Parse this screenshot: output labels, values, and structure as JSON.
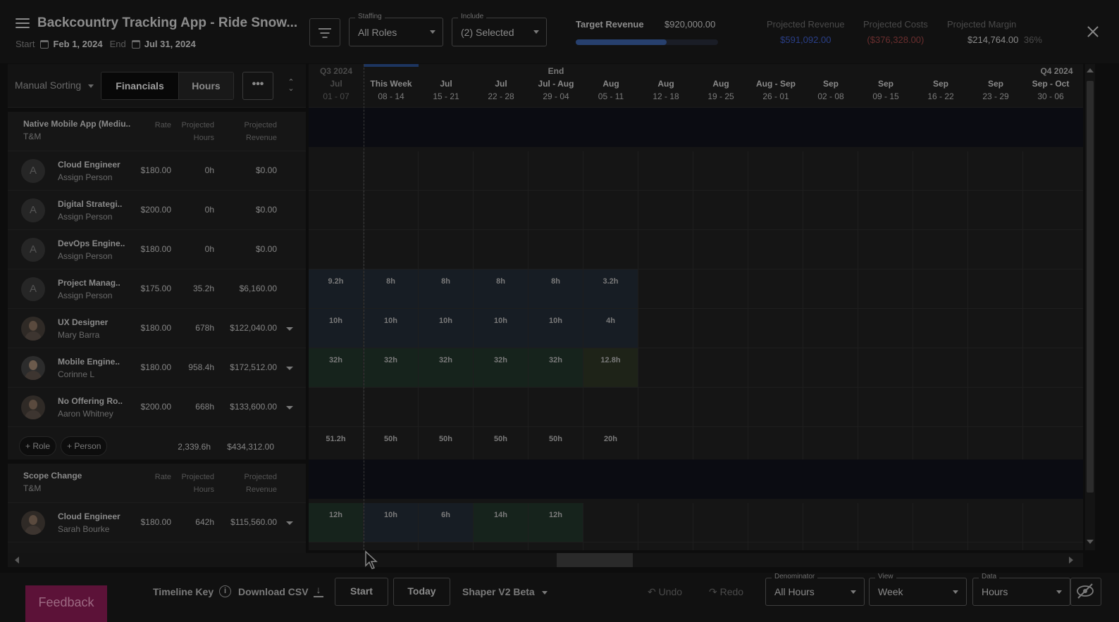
{
  "header": {
    "title": "Backcountry Tracking App - Ride Snow...",
    "start_label": "Start",
    "start_date": "Feb 1, 2024",
    "end_label": "End",
    "end_date": "Jul 31, 2024",
    "staffing": {
      "label": "Staffing",
      "value": "All Roles"
    },
    "include": {
      "label": "Include",
      "value": "(2) Selected"
    },
    "target_revenue": {
      "label": "Target Revenue",
      "value": "$920,000.00",
      "progress_fraction": 0.64
    },
    "projected_revenue": {
      "label": "Projected Revenue",
      "value": "$591,092.00",
      "color": "#2a3f88"
    },
    "projected_costs": {
      "label": "Projected Costs",
      "value": "($376,328.00)",
      "color": "#6a2e2e"
    },
    "projected_margin": {
      "label": "Projected Margin",
      "value": "$214,764.00",
      "percent": "36%"
    }
  },
  "panel": {
    "sorting": "Manual Sorting",
    "tab_financials": "Financials",
    "tab_hours": "Hours",
    "more": "•••"
  },
  "columns": {
    "rate": "Rate",
    "proj_hours_1": "Projected",
    "proj_hours_2": "Hours",
    "proj_rev_1": "Projected",
    "proj_rev_2": "Revenue"
  },
  "sections": [
    {
      "name": "Native Mobile App (Mediu..",
      "type": "T&M",
      "rows": [
        {
          "role": "Cloud Engineer",
          "person": "Assign Person",
          "avatar": "A",
          "rate": "$180.00",
          "hours": "0h",
          "revenue": "$0.00"
        },
        {
          "role": "Digital Strategi..",
          "person": "Assign Person",
          "avatar": "A",
          "rate": "$200.00",
          "hours": "0h",
          "revenue": "$0.00"
        },
        {
          "role": "DevOps Engine..",
          "person": "Assign Person",
          "avatar": "A",
          "rate": "$180.00",
          "hours": "0h",
          "revenue": "$0.00"
        },
        {
          "role": "Project Manag..",
          "person": "Assign Person",
          "avatar": "A",
          "rate": "$175.00",
          "hours": "35.2h",
          "revenue": "$6,160.00"
        },
        {
          "role": "UX Designer",
          "person": "Mary Barra",
          "avatar": "",
          "rate": "$180.00",
          "hours": "678h",
          "revenue": "$122,040.00"
        },
        {
          "role": "Mobile Engine..",
          "person": "Corinne L",
          "avatar": "",
          "rate": "$180.00",
          "hours": "958.4h",
          "revenue": "$172,512.00"
        },
        {
          "role": "No Offering Ro..",
          "person": "Aaron Whitney",
          "avatar": "",
          "rate": "$200.00",
          "hours": "668h",
          "revenue": "$133,600.00"
        }
      ],
      "footer": {
        "add_role": "+ Role",
        "add_person": "+ Person",
        "total_hours": "2,339.6h",
        "total_revenue": "$434,312.00"
      }
    },
    {
      "name": "Scope Change",
      "type": "T&M",
      "rows": [
        {
          "role": "Cloud Engineer",
          "person": "Sarah Bourke",
          "avatar": "",
          "rate": "$180.00",
          "hours": "642h",
          "revenue": "$115,560.00"
        }
      ]
    }
  ],
  "timeline": {
    "weeks": [
      {
        "quarter": "Q3 2024",
        "month": "Jul",
        "days": "01 - 07"
      },
      {
        "quarter": "",
        "month": "This Week",
        "days": "08 - 14"
      },
      {
        "quarter": "",
        "month": "Jul",
        "days": "15 - 21"
      },
      {
        "quarter": "",
        "month": "Jul",
        "days": "22 - 28"
      },
      {
        "quarter": "End",
        "month": "Jul - Aug",
        "days": "29 - 04"
      },
      {
        "quarter": "",
        "month": "Aug",
        "days": "05 - 11"
      },
      {
        "quarter": "",
        "month": "Aug",
        "days": "12 - 18"
      },
      {
        "quarter": "",
        "month": "Aug",
        "days": "19 - 25"
      },
      {
        "quarter": "",
        "month": "Aug - Sep",
        "days": "26 - 01"
      },
      {
        "quarter": "",
        "month": "Sep",
        "days": "02 - 08"
      },
      {
        "quarter": "",
        "month": "Sep",
        "days": "09 - 15"
      },
      {
        "quarter": "",
        "month": "Sep",
        "days": "16 - 22"
      },
      {
        "quarter": "",
        "month": "Sep",
        "days": "23 - 29"
      },
      {
        "quarter": "Q4 2024",
        "month": "Sep - Oct",
        "days": "30 - 06"
      }
    ],
    "rows": [
      {
        "cells": [
          "9.2h",
          "8h",
          "8h",
          "8h",
          "8h",
          "3.2h"
        ],
        "tone": "blue"
      },
      {
        "cells": [
          "10h",
          "10h",
          "10h",
          "10h",
          "10h",
          "4h"
        ],
        "tone": "blue"
      },
      {
        "cells": [
          "32h",
          "32h",
          "32h",
          "32h",
          "32h",
          "12.8h"
        ],
        "tone": "green",
        "last_tone": "yellow"
      },
      {
        "cells": [],
        "tone": "none"
      },
      {
        "cells": [
          "51.2h",
          "50h",
          "50h",
          "50h",
          "50h",
          "20h"
        ],
        "tone": "none"
      },
      {
        "cells": [
          "12h",
          "10h",
          "6h",
          "14h",
          "12h"
        ],
        "tones": [
          "green",
          "blue",
          "blue",
          "green",
          "green"
        ]
      }
    ]
  },
  "bottom": {
    "feedback": "Feedback",
    "timeline_key": "Timeline Key",
    "download_csv": "Download CSV",
    "start": "Start",
    "today": "Today",
    "shaper": "Shaper V2 Beta",
    "undo": "Undo",
    "redo": "Redo",
    "denominator": {
      "label": "Denominator",
      "value": "All Hours"
    },
    "view": {
      "label": "View",
      "value": "Week"
    },
    "data": {
      "label": "Data",
      "value": "Hours"
    }
  }
}
